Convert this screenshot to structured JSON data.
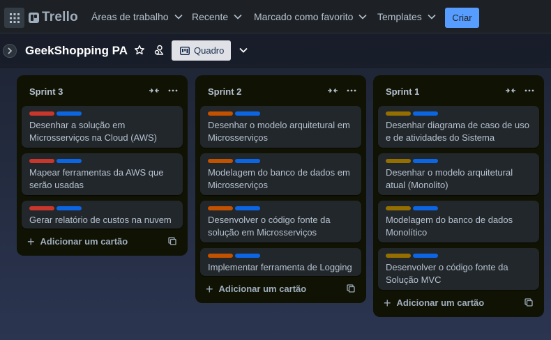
{
  "nav": {
    "logo": "Trello",
    "items": [
      "Áreas de trabalho",
      "Recente",
      "Marcado como favorito",
      "Templates"
    ],
    "create_label": "Criar"
  },
  "board": {
    "title": "GeekShopping PA",
    "view_label": "Quadro"
  },
  "colors": {
    "label_red": "#c9372c",
    "label_orange": "#c25100",
    "label_yellow": "#946f00",
    "label_blue": "#0c66e4"
  },
  "lists": [
    {
      "title": "Sprint 3",
      "add_label": "Adicionar um cartão",
      "cards": [
        {
          "title": "Desenhar a solução em Microsserviços na Cloud (AWS)",
          "labels": [
            "#c9372c",
            "#0c66e4"
          ]
        },
        {
          "title": "Mapear ferramentas da AWS que serão usadas",
          "labels": [
            "#c9372c",
            "#0c66e4"
          ]
        },
        {
          "title": "Gerar relatório de custos na nuvem",
          "labels": [
            "#c9372c",
            "#0c66e4"
          ]
        }
      ]
    },
    {
      "title": "Sprint 2",
      "add_label": "Adicionar um cartão",
      "cards": [
        {
          "title": "Desenhar o modelo arquitetural em Microsserviços",
          "labels": [
            "#c25100",
            "#0c66e4"
          ]
        },
        {
          "title": "Modelagem do banco de dados em Microsserviços",
          "labels": [
            "#c25100",
            "#0c66e4"
          ]
        },
        {
          "title": "Desenvolver o código fonte da solução em Microsserviços",
          "labels": [
            "#c25100",
            "#0c66e4"
          ]
        },
        {
          "title": "Implementar ferramenta de Logging",
          "labels": [
            "#c25100",
            "#0c66e4"
          ]
        }
      ]
    },
    {
      "title": "Sprint 1",
      "add_label": "Adicionar um cartão",
      "cards": [
        {
          "title": "Desenhar diagrama de caso de uso e de atividades do Sistema",
          "labels": [
            "#946f00",
            "#0c66e4"
          ]
        },
        {
          "title": "Desenhar o modelo arquitetural atual (Monolito)",
          "labels": [
            "#946f00",
            "#0c66e4"
          ]
        },
        {
          "title": "Modelagem do banco de dados Monolítico",
          "labels": [
            "#946f00",
            "#0c66e4"
          ]
        },
        {
          "title": "Desenvolver o código fonte da Solução MVC",
          "labels": [
            "#946f00",
            "#0c66e4"
          ]
        }
      ]
    }
  ]
}
